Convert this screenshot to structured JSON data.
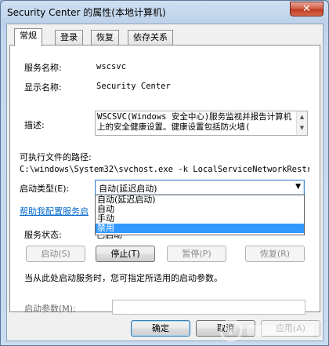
{
  "window": {
    "title": "Security Center 的属性(本地计算机)",
    "close_glyph": "✕"
  },
  "tabs": [
    {
      "label": "常规",
      "active": true
    },
    {
      "label": "登录",
      "active": false
    },
    {
      "label": "恢复",
      "active": false
    },
    {
      "label": "依存关系",
      "active": false
    }
  ],
  "general": {
    "service_name_label": "服务名称:",
    "service_name_value": "wscsvc",
    "display_name_label": "显示名称:",
    "display_name_value": "Security Center",
    "description_label": "描述:",
    "description_value": "WSCSVC(Windows 安全中心)服务监视并报告计算机上的安全健康设置。健康设置包括防火墙(",
    "exe_path_label": "可执行文件的路径:",
    "exe_path_value": "C:\\windows\\System32\\svchost.exe -k LocalServiceNetworkRestri",
    "startup_type_label": "启动类型(E):",
    "startup_type_value": "自动(延迟启动)",
    "startup_options": [
      "自动(延迟启动)",
      "自动",
      "手动",
      "禁用"
    ],
    "startup_selected_index": 3,
    "help_link": "帮助我配置服务启",
    "service_status_label": "服务状态:",
    "service_status_value": "已启动",
    "buttons": {
      "start": "启动(S)",
      "stop": "停止(T)",
      "pause": "暂停(P)",
      "resume": "恢复(R)"
    },
    "hint_text": "当从此处启动服务时，您可指定所适用的启动参数。",
    "start_params_label": "启动参数(M):",
    "start_params_value": ""
  },
  "footer": {
    "ok": "确定",
    "cancel": "取消",
    "apply": "应用(A)"
  },
  "colors": {
    "selection": "#3399ff",
    "link": "#0066cc",
    "close": "#c13a22"
  },
  "icons": [
    "close-icon",
    "dropdown-arrow-icon",
    "scroll-up-icon",
    "scroll-down-icon"
  ]
}
